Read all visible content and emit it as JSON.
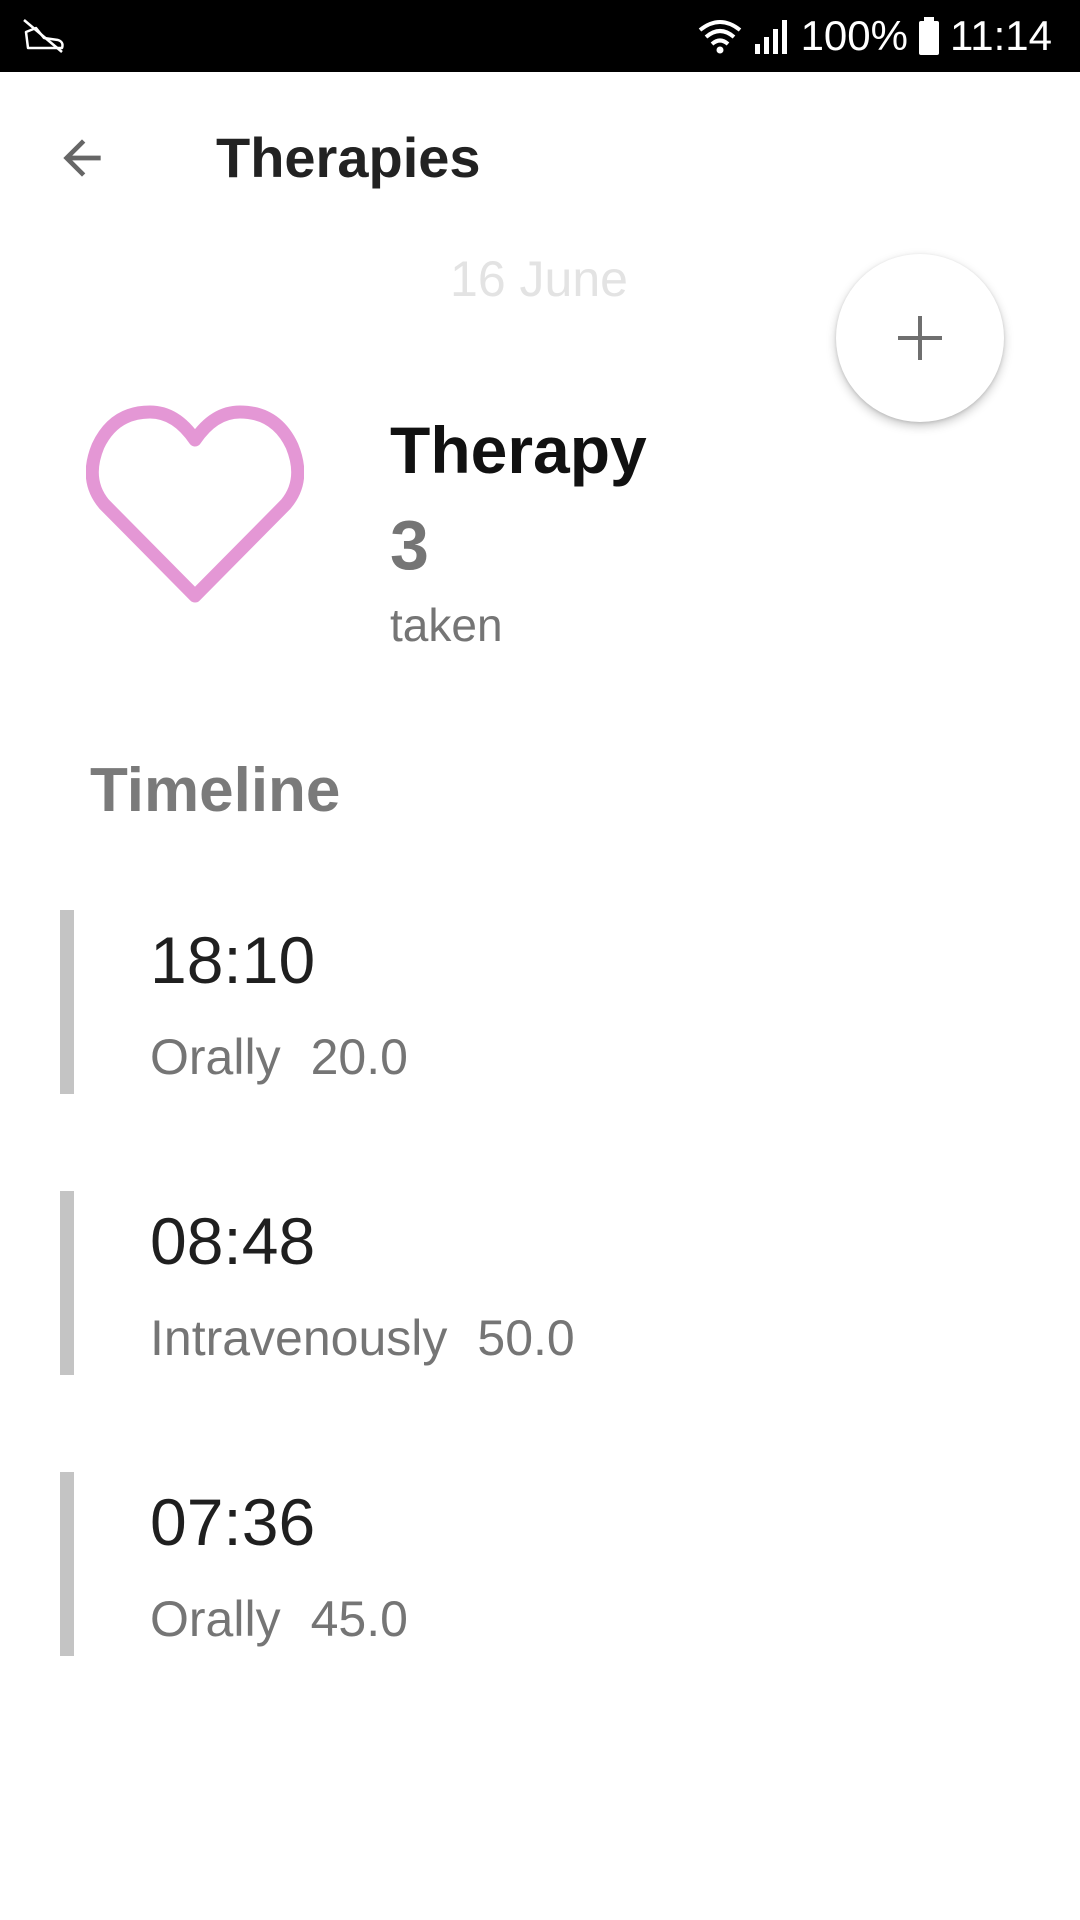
{
  "status_bar": {
    "battery": "100%",
    "time": "11:14",
    "left_icon": "shoe-notification-icon",
    "icons": [
      "wifi-icon",
      "signal-icon",
      "battery-icon"
    ]
  },
  "app_bar": {
    "title": "Therapies",
    "back_icon": "arrow-back-icon"
  },
  "date": "16 June",
  "fab": {
    "icon": "plus-icon"
  },
  "summary": {
    "icon": "heart-icon",
    "icon_color": "#e497d5",
    "title": "Therapy",
    "count": "3",
    "caption": "taken"
  },
  "timeline": {
    "title": "Timeline",
    "entries": [
      {
        "time": "18:10",
        "route": "Orally",
        "dose": "20.0"
      },
      {
        "time": "08:48",
        "route": "Intravenously",
        "dose": "50.0"
      },
      {
        "time": "07:36",
        "route": "Orally",
        "dose": "45.0"
      }
    ]
  }
}
